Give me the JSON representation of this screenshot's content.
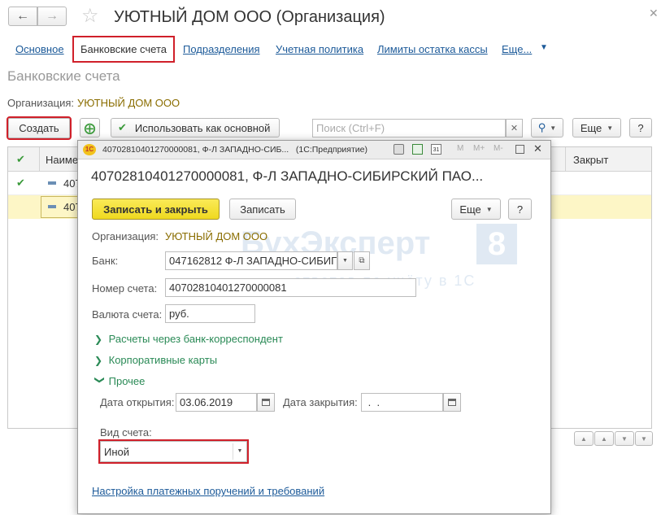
{
  "window": {
    "title": "УЮТНЫЙ ДОМ ООО (Организация)"
  },
  "nav_tabs": [
    {
      "label": "Основное"
    },
    {
      "label": "Банковские счета"
    },
    {
      "label": "Подразделения"
    },
    {
      "label": "Учетная политика"
    },
    {
      "label": "Лимиты остатка кассы"
    },
    {
      "label": "Еще..."
    }
  ],
  "list": {
    "title": "Банковские счета",
    "org_label": "Организация:",
    "org_value": "УЮТНЫЙ ДОМ ООО",
    "create_label": "Создать",
    "use_main_label": "Использовать как основной",
    "search_placeholder": "Поиск (Ctrl+F)",
    "more_label": "Еще",
    "help_label": "?",
    "columns": {
      "name": "Наиме",
      "closed": "Закрыт"
    },
    "rows": [
      {
        "name": "407"
      },
      {
        "name": "407"
      }
    ]
  },
  "dialog": {
    "titlebar": "40702810401270000081, Ф-Л ЗАПАДНО-СИБ...   (1С:Предприятие)",
    "tb_m": "M",
    "tb_mplus": "M+",
    "tb_mminus": "M-",
    "heading": "40702810401270000081, Ф-Л ЗАПАДНО-СИБИРСКИЙ ПАО...",
    "save_close_label": "Записать и закрыть",
    "save_label": "Записать",
    "more_label": "Еще",
    "help_label": "?",
    "org_label": "Организация:",
    "org_value": "УЮТНЫЙ ДОМ ООО",
    "bank_label": "Банк:",
    "bank_value": "047162812 Ф-Л ЗАПАДНО-СИБИГ",
    "account_label": "Номер счета:",
    "account_value": "40702810401270000081",
    "currency_label": "Валюта счета:",
    "currency_value": "руб.",
    "groups": [
      {
        "label": "Расчеты через банк-корреспондент",
        "expanded": false
      },
      {
        "label": "Корпоративные карты",
        "expanded": false
      },
      {
        "label": "Прочее",
        "expanded": true
      }
    ],
    "open_date_label": "Дата открытия:",
    "open_date_value": "03.06.2019",
    "close_date_label": "Дата закрытия:",
    "close_date_value": " .  .",
    "account_type_label": "Вид счета:",
    "account_type_value": "Иной",
    "payment_settings_link": "Настройка платежных поручений и требований"
  },
  "watermark": {
    "brand": "БухЭксперт",
    "digit": "8",
    "tagline": "ответов по учёту в 1С"
  },
  "colors": {
    "red_frame": "#d0202a",
    "save_close_bg": "#f6e23c",
    "link": "#1c5a99",
    "group_green": "#2a8a56",
    "row_highlight": "#fdf6c6"
  }
}
